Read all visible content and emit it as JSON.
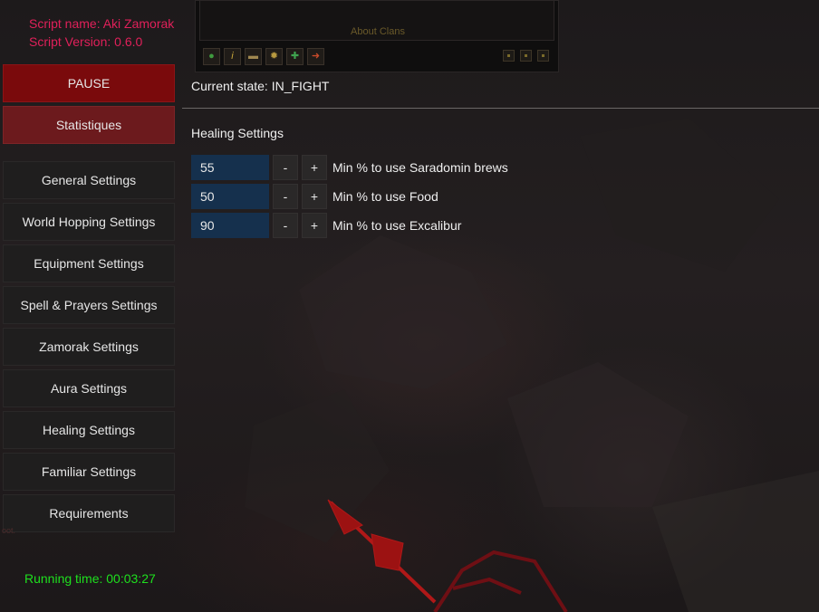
{
  "script": {
    "name_line": "Script name: Aki Zamorak",
    "version_line": "Script Version: 0.6.0"
  },
  "game": {
    "about_clans": "About Clans",
    "toolbar_icons": [
      "chat-icon",
      "info-icon",
      "folder-icon",
      "gear-icon",
      "add-friend-icon",
      "logout-icon"
    ]
  },
  "sidebar": {
    "pause_label": "PAUSE",
    "stats_label": "Statistiques",
    "items": [
      {
        "label": "General Settings"
      },
      {
        "label": "World Hopping Settings"
      },
      {
        "label": "Equipment Settings"
      },
      {
        "label": "Spell & Prayers Settings"
      },
      {
        "label": "Zamorak Settings"
      },
      {
        "label": "Aura Settings"
      },
      {
        "label": "Healing Settings"
      },
      {
        "label": "Familiar Settings"
      },
      {
        "label": "Requirements"
      }
    ]
  },
  "status": {
    "current_state": "Current state: IN_FIGHT",
    "running_time": "Running time: 00:03:27"
  },
  "background_text": "oot.",
  "healing": {
    "title": "Healing Settings",
    "rows": [
      {
        "value": "55",
        "minus": "-",
        "plus": "+",
        "label": "Min % to use Saradomin brews"
      },
      {
        "value": "50",
        "minus": "-",
        "plus": "+",
        "label": "Min % to use Food"
      },
      {
        "value": "90",
        "minus": "-",
        "plus": "+",
        "label": "Min % to use Excalibur"
      }
    ]
  },
  "colors": {
    "script_text": "#e0205a",
    "pause_button": "#7a0a0c",
    "stats_button": "#6c1a1d",
    "running_time": "#1ee01e",
    "input_bg": "#15304d"
  }
}
